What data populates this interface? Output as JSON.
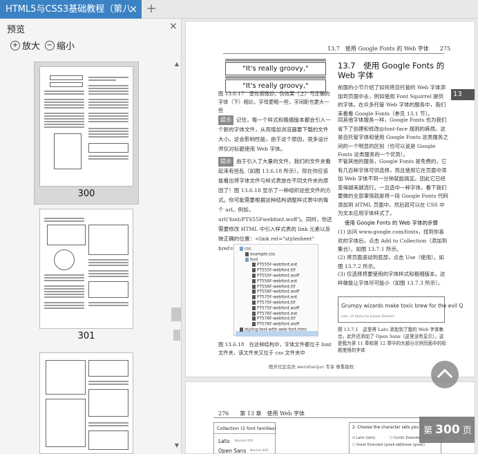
{
  "app": {
    "tab_title": "HTML5与CSS3基础教程（第八",
    "tab_close": "×",
    "new_tab": "+"
  },
  "sidebar": {
    "title": "预览",
    "close": "×",
    "zoom_in": "放大",
    "zoom_out": "缩小",
    "thumbs": [
      {
        "page": "300"
      },
      {
        "page": "301"
      }
    ]
  },
  "page": {
    "running_head": "13.7　使用 Google Fonts 的 Web 字体　　275",
    "chapter_tab": "13",
    "groovy1": "\"It's really groovy,\"",
    "groovy2": "\"It's really groovy,\"",
    "fig_caption_1": "图 13.6.17　变化很微妙。伪效果（上）与正确的字体（下）相比，字母更粗一些，字间距也更大一些",
    "tip1_label": "提示",
    "tip1_text": "记住，每一个样式和粗细版本都会引入一个新的字体文件，从而增加浏览器要下载的文件大小。这会影响性能，由于这个原因，很多设计师仅对标题使用 Web 字体。",
    "tip2_label": "提示",
    "tip2_text": "由于引入了大量的文件，我们的文件夹看起来有些乱（如图 13.6.18 所示）。现在你应该能看出将字体文件与样式表放在不同文件夹的原因了！图 13.6.18 显示了一种组织这些文件的方式。你可能需要根据这种结构调整样式表中的每个 url。例如，url('font/PTS55Fwebfont.woff')。同时，你还需要修改 HTML 中引入样式表的 link 元素以反映正确的位置：<link rel=\"stylesheet\" href=\"css/example.css\" />。",
    "file_tree": [
      "css",
      "example.css",
      "font",
      "PT555F-webfont.eot",
      "PT555F-webfont.ttf",
      "PT555F-webfont.woff",
      "PT556F-webfont.eot",
      "PT556F-webfont.ttf",
      "PT556F-webfont.woff",
      "PT575F-webfont.eot",
      "PT575F-webfont.ttf",
      "PT575F-webfont.woff",
      "PT576F-webfont.eot",
      "PT576F-webfont.ttf",
      "PT576F-webfont.woff",
      "styling-text-with-web-font.html"
    ],
    "fig_caption_2": "图 13.6.18　在这种结构中，字体文件都位于 font 文件夹，该文件夹又位于 css 文件夹中",
    "watermark": "图灵社区会员 wenshanjun 专享 尊重版权",
    "section_title": "13.7　使用 Google Fonts 的 Web 字体",
    "para1": "前面的小节介绍了如何将自托管的 Web 字体添加到页面中去，例如使用 Font Squirrel 提供的字体。在众多托管 Web 字体的服务中，我们来看看 Google Fonts（参见 13.1 节）。",
    "para2": "同其他字体服务一样，Google Fonts 也为我们省下了创建和修改@font-face 规则的麻烦。这是自托管字体和使用 Google Fonts 这类服务之间的一个明显的区别（也可以说是 Google Fonts 这类服务的一个优势）。",
    "para3": "不管其他的服务，Google Fonts 是免费的，它有几百种字体可供选择，而且使用它在页面中添加 Web 字体不到一分钟就能搞定。因此它已经变得越来越流行。一旦选中一种字体，看下我们要做的全部事情就是将一段 Google Fonts 代码添加到 HTML 页面中，然后就可以在 CSS 中为文本应用字体样式了。",
    "steps_title": "使用 Google Fonts 的 Web 字体的步骤",
    "step1": "(1) 访问 www.google.com/fonts，找到你喜欢的字体后，点击 Add to Collection（添加到集合）。如图 13.7.1 所示。",
    "step2": "(2) 将页面滚动到底部，点击 Use（使用）。如图 13.7.2 所示。",
    "step3": "(3) 仅选择将要使用的字体样式和粗细版本。这样做能让字体尽可能小（如图 13.7.3 所示）。",
    "shot_text": "Grumpy wizards make toxic brew for the evil Q",
    "shot_sub": "Lato, 10 Styles by Łukasz Dziedzic",
    "fig_caption_3": "图 13.7.1　这里将 Lato 添加到了我的 Web 字体集合。此外还添加了 Open Sans（这里没有显示）。这是我为第 11 章和第 12 章中的大部分示例页面中的标题使用的字体",
    "sidenote": "前面的小节..."
  },
  "page2": {
    "running_head": "276　　第 13 章　使用 Web 字体",
    "collection_title": "Collection (2 font families)",
    "font1": "Lato",
    "font1_meta": "Normal 400",
    "font2": "Open Sans",
    "font2_meta": "Normal 400",
    "charset_title": "2. Choose the character sets you want",
    "charset1": "Latin (latin)",
    "charset2": "Cyrillic Extended (cyrillic-ext)",
    "charset3": "Greek Extended (greek-ext)",
    "charset4": "Greek (greek)"
  },
  "viewer": {
    "page_badge_prefix": "第",
    "page_badge_num": "300",
    "page_badge_suffix": "页"
  }
}
